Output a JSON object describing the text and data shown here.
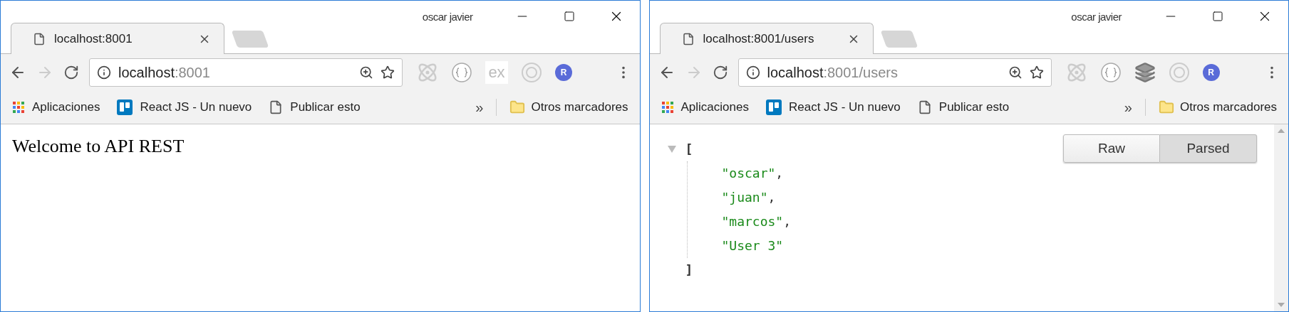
{
  "windows": [
    {
      "user": "oscar javier",
      "tab": {
        "title": "localhost:8001"
      },
      "address": {
        "host": "localhost",
        "port": ":8001"
      },
      "extensions": [
        {
          "kind": "atom"
        },
        {
          "kind": "braces"
        },
        {
          "kind": "text",
          "label": "ex"
        },
        {
          "kind": "target"
        },
        {
          "kind": "badge",
          "label": "R"
        }
      ],
      "bookmarks": [
        {
          "kind": "apps",
          "label": "Aplicaciones"
        },
        {
          "kind": "board",
          "label": "React JS - Un nuevo"
        },
        {
          "kind": "page",
          "label": "Publicar esto"
        }
      ],
      "overflow": "»",
      "other_bookmarks": "Otros marcadores",
      "page": {
        "kind": "text",
        "text": "Welcome to API REST"
      }
    },
    {
      "user": "oscar javier",
      "tab": {
        "title": "localhost:8001/users"
      },
      "address": {
        "host": "localhost",
        "port": ":8001/users"
      },
      "extensions": [
        {
          "kind": "atom"
        },
        {
          "kind": "braces"
        },
        {
          "kind": "layers"
        },
        {
          "kind": "target"
        },
        {
          "kind": "badge",
          "label": "R"
        }
      ],
      "bookmarks": [
        {
          "kind": "apps",
          "label": "Aplicaciones"
        },
        {
          "kind": "board",
          "label": "React JS - Un nuevo"
        },
        {
          "kind": "page",
          "label": "Publicar esto"
        }
      ],
      "overflow": "»",
      "other_bookmarks": "Otros marcadores",
      "page": {
        "kind": "json",
        "open": "[",
        "close": "]",
        "items": [
          {
            "value": "\"oscar\"",
            "sep": ","
          },
          {
            "value": "\"juan\"",
            "sep": ","
          },
          {
            "value": "\"marcos\"",
            "sep": ","
          },
          {
            "value": "\"User 3\""
          }
        ],
        "view_buttons": [
          {
            "label": "Raw",
            "selected": false
          },
          {
            "label": "Parsed",
            "selected": true
          }
        ]
      }
    }
  ]
}
